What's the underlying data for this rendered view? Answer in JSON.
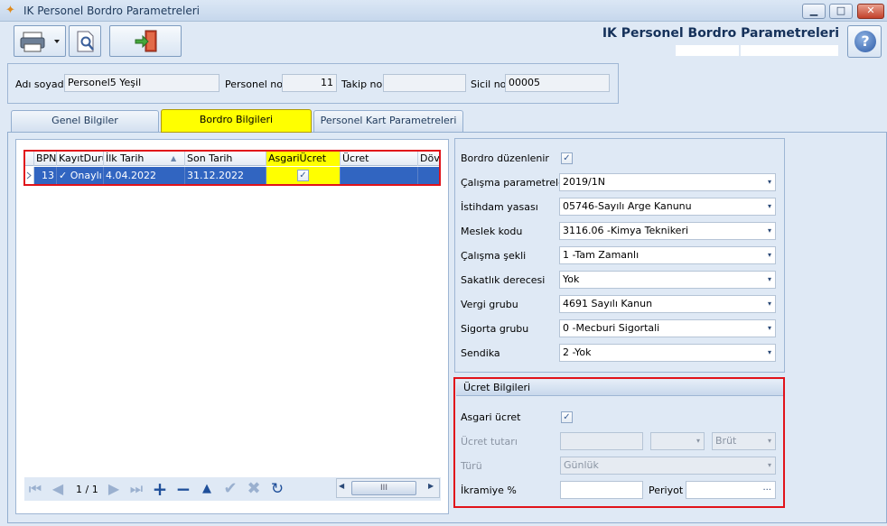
{
  "window": {
    "title": "IK Personel Bordro Parametreleri",
    "minimize": "▁",
    "maximize": "□",
    "close": "✕"
  },
  "header": {
    "title": "IK Personel Bordro Parametreleri",
    "help": "?"
  },
  "info": {
    "name_label": "Adı soyadı",
    "name_value": "Personel5 Yeşil",
    "personel_no_label": "Personel no",
    "personel_no_value": "11",
    "takip_no_label": "Takip no",
    "takip_no_value": "",
    "sicil_no_label": "Sicil no",
    "sicil_no_value": "00005"
  },
  "tabs": [
    {
      "label": "Genel Bilgiler"
    },
    {
      "label": "Bordro Bilgileri"
    },
    {
      "label": "Personel Kart Parametreleri"
    }
  ],
  "grid": {
    "columns": [
      "BPN",
      "KayıtDurumu",
      "İlk Tarih",
      "Son Tarih",
      "AsgariÜcret",
      "Ücret",
      "Döv"
    ],
    "row": {
      "bpn": "13",
      "durum": "✓ Onaylı",
      "ilk_tarih": "4.04.2022",
      "son_tarih": "31.12.2022",
      "asgari": "✓",
      "ucret": "",
      "dov": ""
    },
    "pager": "1 / 1",
    "scroll_grip": "III"
  },
  "params": {
    "bordro_duzenlenir_label": "Bordro düzenlenir",
    "bordro_duzenlenir_check": "✓",
    "calisma_param_label": "Çalışma parametreleri",
    "calisma_param_value": "2019/1N",
    "istihdam_label": "İstihdam yasası",
    "istihdam_value": "05746-Sayılı Arge Kanunu",
    "meslek_label": "Meslek kodu",
    "meslek_value": "3116.06 -Kimya Teknikeri",
    "calisma_sekli_label": "Çalışma şekli",
    "calisma_sekli_value": "1 -Tam Zamanlı",
    "sakatlik_label": "Sakatlık derecesi",
    "sakatlik_value": "Yok",
    "vergi_label": "Vergi grubu",
    "vergi_value": "4691 Sayılı Kanun",
    "sigorta_label": "Sigorta grubu",
    "sigorta_value": "0 -Mecburi Sigortali",
    "sendika_label": "Sendika",
    "sendika_value": "2 -Yok",
    "arrow": "▾"
  },
  "ucret": {
    "header": "Ücret Bilgileri",
    "asgari_label": "Asgari ücret",
    "asgari_check": "✓",
    "tutar_label": "Ücret tutarı",
    "brut_value": "Brüt",
    "turu_label": "Türü",
    "turu_value": "Günlük",
    "ikramiye_label": "İkramiye %",
    "periyot_label": "Periyot",
    "periyot_dots": "..."
  }
}
